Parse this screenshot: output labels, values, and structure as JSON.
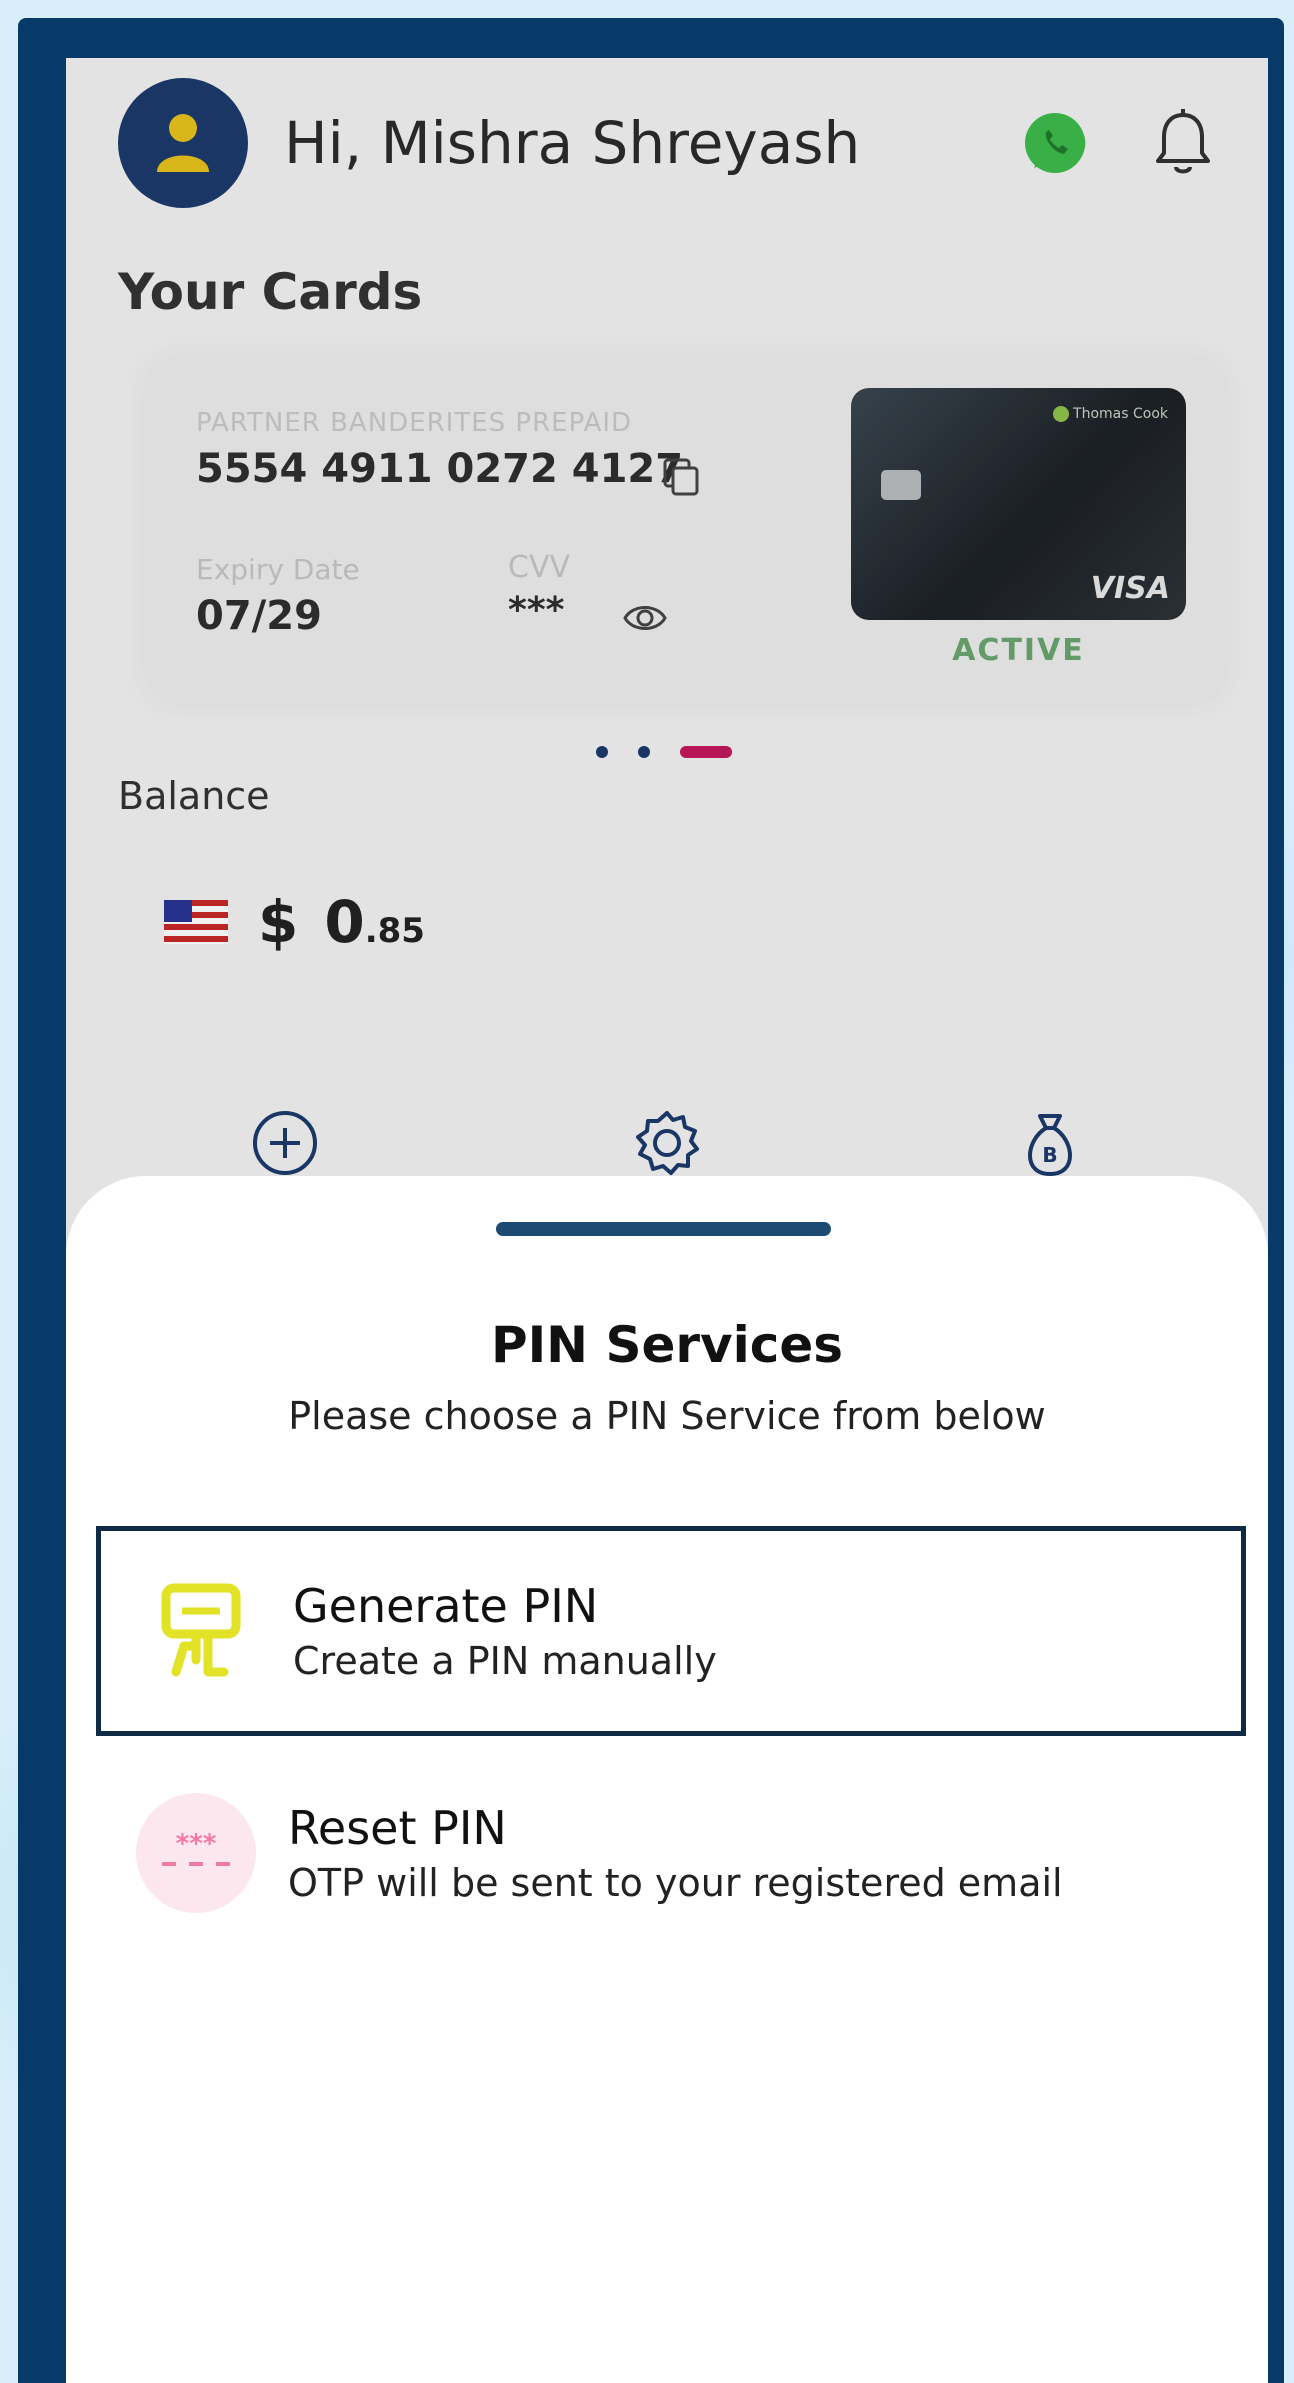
{
  "header": {
    "greeting": "Hi, Mishra Shreyash"
  },
  "cards_section": {
    "title": "Your Cards",
    "card": {
      "type_label": "PARTNER BANDERITES PREPAID",
      "number": "5554 4911 0272 4127",
      "expiry_label": "Expiry Date",
      "expiry_value": "07/29",
      "cvv_label": "CVV",
      "cvv_value": "***",
      "status": "ACTIVE",
      "network": "VISA",
      "brand": "Thomas Cook"
    },
    "pager": {
      "count": 3,
      "active_index": 2
    }
  },
  "balance": {
    "label": "Balance",
    "currency_symbol": "$",
    "amount_main": "0",
    "amount_decimal": ".85"
  },
  "actions": [
    "plus-circle-icon",
    "gear-icon",
    "money-bag-icon"
  ],
  "sheet": {
    "title": "PIN Services",
    "subtitle": "Please choose a PIN Service from below",
    "options": [
      {
        "title": "Generate PIN",
        "description": "Create a PIN manually",
        "icon": "pin-pad-icon",
        "selected": true
      },
      {
        "title": "Reset PIN",
        "description": "OTP will be sent to your registered email",
        "icon": "masked-pin-icon",
        "selected": false
      }
    ]
  },
  "colors": {
    "frame": "#073a68",
    "accent_pink": "#c2185b",
    "active_green": "#69a56e",
    "navy": "#1b3a6b",
    "selected_border": "#0e2a44",
    "generate_icon_yellow": "#e2e227",
    "reset_icon_pink": "#f27aa0"
  }
}
